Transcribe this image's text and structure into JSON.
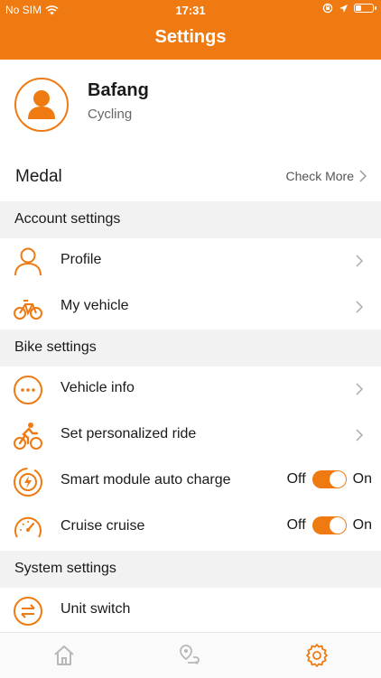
{
  "status_bar": {
    "carrier": "No SIM",
    "time": "17:31",
    "icons": [
      "wifi-icon",
      "orientation-lock-icon",
      "location-arrow-icon",
      "battery-icon"
    ]
  },
  "header": {
    "title": "Settings"
  },
  "profile": {
    "name": "Bafang",
    "subtitle": "Cycling",
    "avatar_icon": "person-icon"
  },
  "medal": {
    "label": "Medal",
    "action": "Check More"
  },
  "sections": {
    "account": {
      "title": "Account settings",
      "items": [
        {
          "label": "Profile",
          "icon": "person-outline-icon"
        },
        {
          "label": "My vehicle",
          "icon": "bicycle-icon"
        }
      ]
    },
    "bike": {
      "title": "Bike settings",
      "items": [
        {
          "label": "Vehicle info",
          "icon": "more-dots-icon"
        },
        {
          "label": "Set personalized ride",
          "icon": "cyclist-icon"
        },
        {
          "label": "Smart module auto charge",
          "icon": "charge-icon",
          "off": "Off",
          "on": "On",
          "enabled": true
        },
        {
          "label": "Cruise cruise",
          "icon": "speedometer-icon",
          "off": "Off",
          "on": "On",
          "enabled": true
        }
      ]
    },
    "system": {
      "title": "System settings",
      "items": [
        {
          "label": "Unit switch",
          "icon": "swap-arrows-icon"
        }
      ]
    }
  },
  "tabbar": {
    "items": [
      {
        "icon": "home-icon",
        "active": false
      },
      {
        "icon": "route-map-icon",
        "active": false
      },
      {
        "icon": "gear-icon",
        "active": true
      }
    ]
  },
  "colors": {
    "accent": "#ef7a12",
    "section_bg": "#f2f2f2",
    "inactive_icon": "#b8b8b8"
  }
}
